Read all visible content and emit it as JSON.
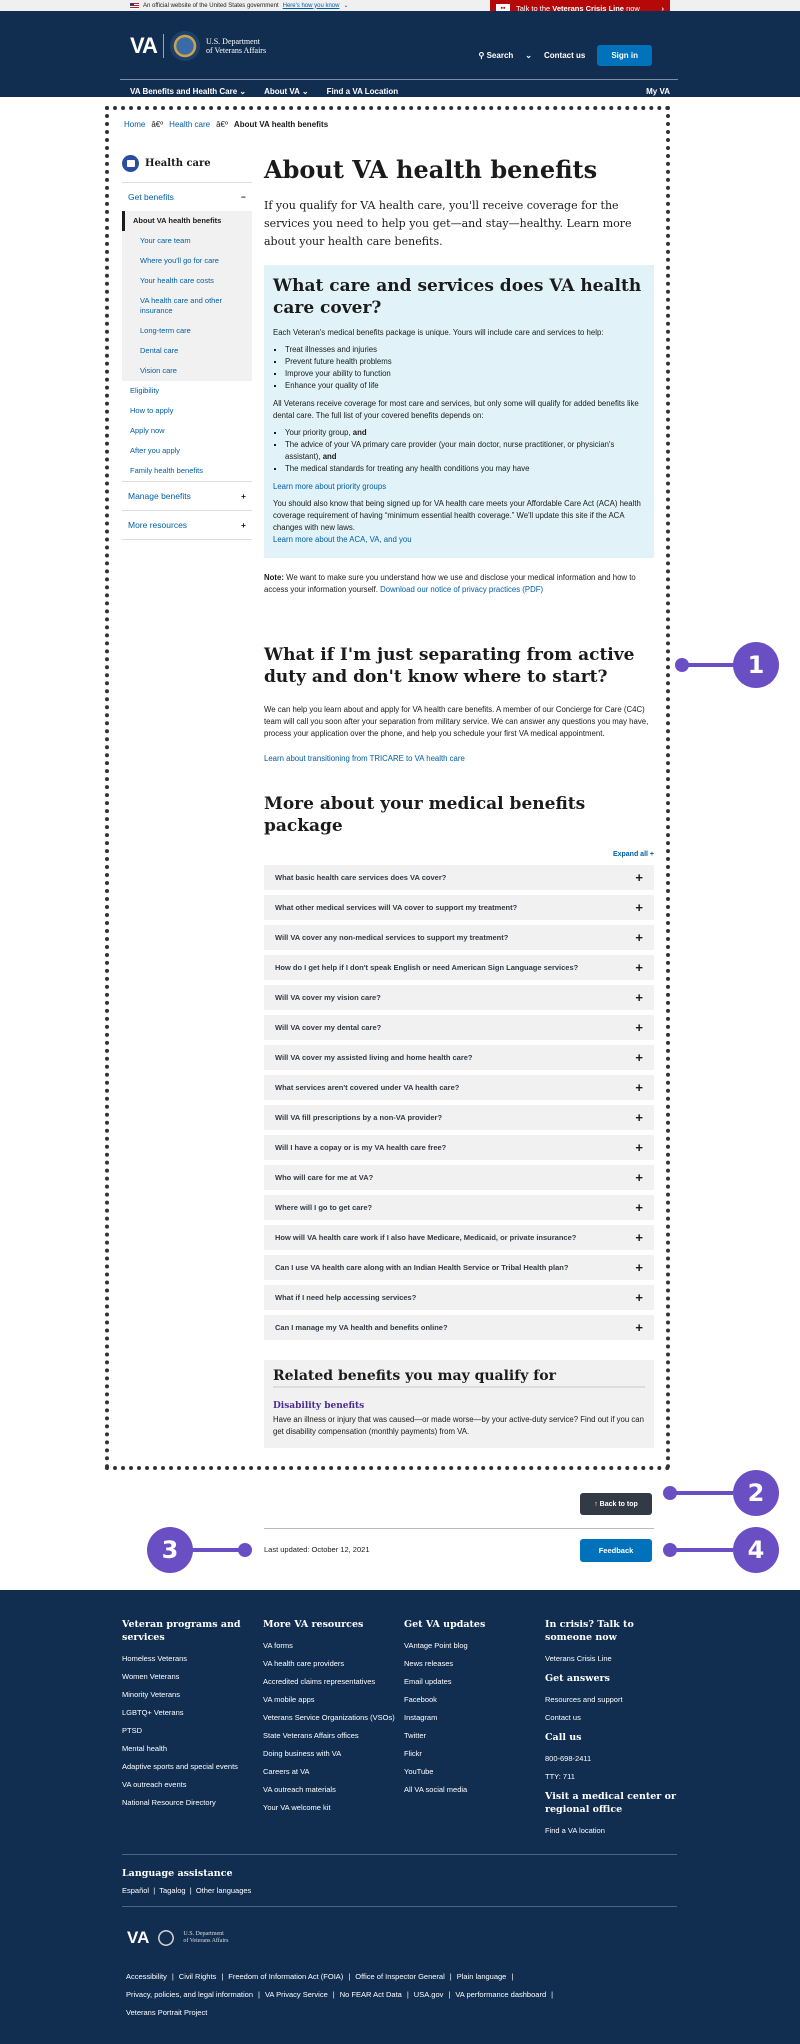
{
  "gov_banner": {
    "text": "An official website of the United States government",
    "link": "Here's how you know"
  },
  "crisis_banner": {
    "prefix": "Talk to the ",
    "bold": "Veterans Crisis Line",
    "suffix": " now",
    "chevron": "›"
  },
  "header": {
    "logo_text": "VA",
    "dept_line1": "U.S. Department",
    "dept_line2": "of Veterans Affairs",
    "search": "Search",
    "contact": "Contact us",
    "signin": "Sign in",
    "nav": [
      "VA Benefits and Health Care",
      "About VA",
      "Find a VA Location"
    ],
    "my_va": "My VA"
  },
  "breadcrumb": {
    "items": [
      "Home",
      "Health care"
    ],
    "separator": "â€º",
    "current": "About VA health benefits"
  },
  "sidebar": {
    "title": "Health care",
    "sections": [
      {
        "label": "Get benefits",
        "toggle": "−"
      },
      {
        "label": "Manage benefits",
        "toggle": "+"
      },
      {
        "label": "More resources",
        "toggle": "+"
      }
    ],
    "active": "About VA health benefits",
    "sub_items": [
      "Your care team",
      "Where you'll go for care",
      "Your health care costs",
      "VA health care and other insurance",
      "Long-term care",
      "Dental care",
      "Vision care"
    ],
    "links": [
      "Eligibility",
      "How to apply",
      "Apply now",
      "After you apply",
      "Family health benefits"
    ]
  },
  "main": {
    "title": "About VA health benefits",
    "intro": "If you qualify for VA health care, you'll receive coverage for the services you need to help you get—and stay—healthy. Learn more about your health care benefits.",
    "box": {
      "title": "What care and services does VA health care cover?",
      "p1": "Each Veteran's medical benefits package is unique. Yours will include care and services to help:",
      "list1": [
        "Treat illnesses and injuries",
        "Prevent future health problems",
        "Improve your ability to function",
        "Enhance your quality of life"
      ],
      "p2": "All Veterans receive coverage for most care and services, but only some will qualify for added benefits like dental care. The full list of your covered benefits depends on:",
      "list2": [
        {
          "text": "Your priority group, ",
          "bold": "and"
        },
        {
          "text": "The advice of your VA primary care provider (your main doctor, nurse practitioner, or physician's assistant), ",
          "bold": "and"
        },
        {
          "text": "The medical standards for treating any health conditions you may have",
          "bold": ""
        }
      ],
      "link1": "Learn more about priority groups",
      "p3": "You should also know that being signed up for VA health care meets your Affordable Care Act (ACA) health coverage requirement of having “minimum essential health coverage.” We'll update this site if the ACA changes with new laws.",
      "link2": "Learn more about the ACA, VA, and you"
    },
    "note_label": "Note:",
    "note_text": " We want to make sure you understand how we use and disclose your medical information and how to access your information yourself. ",
    "note_link": "Download our notice of privacy practices (PDF)",
    "separating_title": "What if I'm just separating from active duty and don't know where to start?",
    "separating_text": "We can help you learn about and apply for VA health care benefits. A member of our Concierge for Care (C4C) team will call you soon after your separation from military service. We can answer any questions you may have, process your application over the phone, and help you schedule your first VA medical appointment.",
    "tricare_link": "Learn about transitioning from TRICARE to VA health care",
    "package_title": "More about your medical benefits package",
    "expand_all": "Expand all +",
    "accordions": [
      "What basic health care services does VA cover?",
      "What other medical services will VA cover to support my treatment?",
      "Will VA cover any non-medical services to support my treatment?",
      "How do I get help if I don't speak English or need American Sign Language services?",
      "Will VA cover my vision care?",
      "Will VA cover my dental care?",
      "Will VA cover my assisted living and home health care?",
      "What services aren't covered under VA health care?",
      "Will VA fill prescriptions by a non-VA provider?",
      "Will I have a copay or is my VA health care free?",
      "Who will care for me at VA?",
      "Where will I go to get care?",
      "How will VA health care work if I also have Medicare, Medicaid, or private insurance?",
      "Can I use VA health care along with an Indian Health Service or Tribal Health plan?",
      "What if I need help accessing services?",
      "Can I manage my VA health and benefits online?"
    ],
    "accordion_icon": "+",
    "related": {
      "title": "Related benefits you may qualify for",
      "link": "Disability benefits",
      "text": "Have an illness or injury that was caused—or made worse—by your active-duty service? Find out if you can get disability compensation (monthly payments) from VA."
    }
  },
  "bottom": {
    "back_to_top": "↑ Back to top",
    "last_updated": "Last updated: October 12, 2021",
    "feedback": "Feedback"
  },
  "annotations": [
    "1",
    "2",
    "3",
    "4"
  ],
  "annotation_color": "#6a4fc4",
  "footer": {
    "col1": {
      "title": "Veteran programs and services",
      "links": [
        "Homeless Veterans",
        "Women Veterans",
        "Minority Veterans",
        "LGBTQ+ Veterans",
        "PTSD",
        "Mental health",
        "Adaptive sports and special events",
        "VA outreach events",
        "National Resource Directory"
      ]
    },
    "col2": {
      "title": "More VA resources",
      "links": [
        "VA forms",
        "VA health care providers",
        "Accredited claims representatives",
        "VA mobile apps",
        "Veterans Service Organizations (VSOs)",
        "State Veterans Affairs offices",
        "Doing business with VA",
        "Careers at VA",
        "VA outreach materials",
        "Your VA welcome kit"
      ]
    },
    "col3": {
      "title": "Get VA updates",
      "links": [
        "VAntage Point blog",
        "News releases",
        "Email updates",
        "Facebook",
        "Instagram",
        "Twitter",
        "Flickr",
        "YouTube",
        "All VA social media"
      ]
    },
    "col4": {
      "crisis_title": "In crisis? Talk to someone now",
      "crisis_link": "Veterans Crisis Line",
      "answers_title": "Get answers",
      "answers_links": [
        "Resources and support",
        "Contact us"
      ],
      "call_title": "Call us",
      "call_links": [
        "800-698-2411",
        "TTY: 711"
      ],
      "visit_title": "Visit a medical center or regional office",
      "visit_link": "Find a VA location"
    },
    "language_title": "Language assistance",
    "languages": [
      "Español",
      "Tagalog",
      "Other languages"
    ],
    "logo_text": "VA",
    "dept_line1": "U.S. Department",
    "dept_line2": "of Veterans Affairs",
    "legal": [
      "Accessibility",
      "Civil Rights",
      "Freedom of Information Act (FOIA)",
      "Office of Inspector General",
      "Plain language",
      "Privacy, policies, and legal information",
      "VA Privacy Service",
      "No FEAR Act Data",
      "USA.gov",
      "VA performance dashboard",
      "Veterans Portrait Project"
    ]
  },
  "colors": {
    "header": "#112e51",
    "link": "#005ea2",
    "crisis": "#b50909",
    "primary_button": "#0071bb",
    "info_box": "#e1f3f8"
  }
}
